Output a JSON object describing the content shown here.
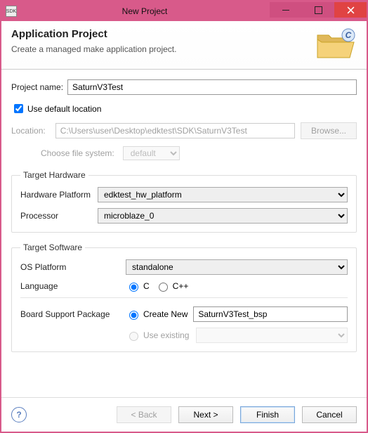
{
  "window": {
    "title": "New Project"
  },
  "header": {
    "title": "Application Project",
    "subtitle": "Create a managed make application project."
  },
  "project": {
    "name_label": "Project name:",
    "name_value": "SaturnV3Test",
    "use_default_label": "Use default location",
    "location_label": "Location:",
    "location_value": "C:\\Users\\user\\Desktop\\edktest\\SDK\\SaturnV3Test",
    "browse_label": "Browse...",
    "choose_fs_label": "Choose file system:",
    "choose_fs_value": "default"
  },
  "target_hardware": {
    "legend": "Target Hardware",
    "hw_platform_label": "Hardware Platform",
    "hw_platform_value": "edktest_hw_platform",
    "processor_label": "Processor",
    "processor_value": "microblaze_0"
  },
  "target_software": {
    "legend": "Target Software",
    "os_label": "OS Platform",
    "os_value": "standalone",
    "language_label": "Language",
    "lang_c": "C",
    "lang_cpp": "C++",
    "bsp_label": "Board Support Package",
    "bsp_create_label": "Create New",
    "bsp_create_value": "SaturnV3Test_bsp",
    "bsp_use_label": "Use existing"
  },
  "footer": {
    "back": "< Back",
    "next": "Next >",
    "finish": "Finish",
    "cancel": "Cancel"
  },
  "appicon_text": "SDK"
}
